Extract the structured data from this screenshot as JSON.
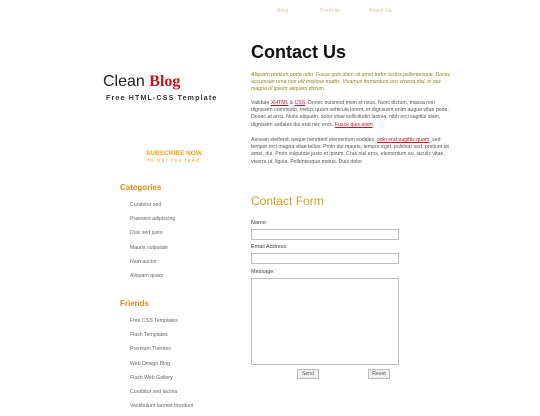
{
  "nav": {
    "items": [
      "Blog",
      "Portfolio",
      "About Us"
    ]
  },
  "sidebar": {
    "logo_clean": "Clean",
    "logo_blog": "Blog",
    "tagline": "Free HTML-CSS Template",
    "subscribe_title": "SUBSCRIBE NOW",
    "subscribe_sub": "to our rss feed",
    "categories_heading": "Categories",
    "categories": [
      "Curabitur sed",
      "Praesent adipiscing",
      "Duis sed justo",
      "Mauris vulputate",
      "Nam auctor",
      "Aliquam quam"
    ],
    "friends_heading": "Friends",
    "friends": [
      "Free CSS Templates",
      "Flash Templates",
      "Premium Themes",
      "Web Design Blog",
      "Flash Web Gallery",
      "Curabitur sed lacinia",
      "Vestibulum laoreet tincidunt"
    ]
  },
  "main": {
    "title": "Contact Us",
    "p1": "Aliquam pretium porta odio. Fusce quis diam sit amet tortor luctus pellentesque. Donec accumsan urna non elit tristique mattis. Vivamus fermentum orci viverra nisl, in nec magna id ipsum aliquam dictum.",
    "p2_a": "Validate ",
    "p2_xhtml": "XHTML",
    "p2_amp": " & ",
    "p2_css": "CSS",
    "p2_b": ". Donec euismod enim et risus. Nunc dictum, massa non dignissim commodo, metus quam vehicula lorem, et dignissim enim augue vitae pede. Donec at arcu. Nunc aliquam, dolor vitae sollicitudin lacinia, nibh orci sagittis diam, dignissim sodales dui erat nec eros. ",
    "p2_link": "Fusce quis enim",
    "p2_c": ".",
    "p3_a": "Aenean eleifend, neque hendrerit elementum sodales, ",
    "p3_link": "odio erat sagittis quam",
    "p3_b": ", sed tempor orci magna vitae tellus. Proin dui mauris, tempor eget, pulvinar sed, pretium sit amet, dui. Proin vulputate justo et ipsum. Cras nisl eros, elementum eu, iaculis vitae, viverra ut, ligula. Pellentesque metus. Duis dolor."
  },
  "form": {
    "title": "Contact Form",
    "name_label": "Name:",
    "name_value": "",
    "email_label": "Email Address:",
    "email_value": "",
    "message_label": "Message:",
    "message_value": "",
    "send_label": "Send",
    "reset_label": "Reset"
  }
}
